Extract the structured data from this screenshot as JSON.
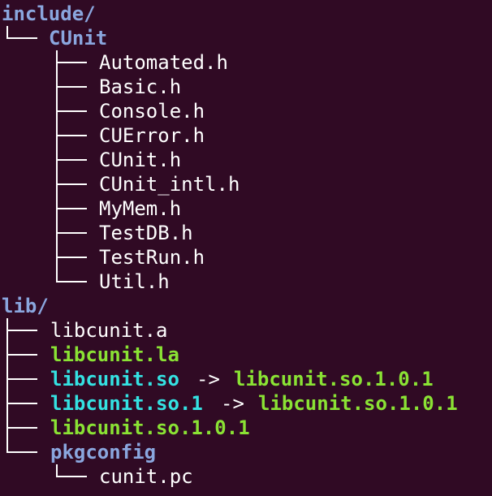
{
  "tree": {
    "include": {
      "label": "include/",
      "sub": {
        "label": "CUnit",
        "files": [
          "Automated.h",
          "Basic.h",
          "Console.h",
          "CUError.h",
          "CUnit.h",
          "CUnit_intl.h",
          "MyMem.h",
          "TestDB.h",
          "TestRun.h",
          "Util.h"
        ]
      }
    },
    "lib": {
      "label": "lib/",
      "items": [
        {
          "name": "libcunit.a",
          "kind": "file"
        },
        {
          "name": "libcunit.la",
          "kind": "exec"
        },
        {
          "name": "libcunit.so",
          "kind": "link",
          "arrow": "->",
          "target": "libcunit.so.1.0.1"
        },
        {
          "name": "libcunit.so.1",
          "kind": "link",
          "arrow": "->",
          "target": "libcunit.so.1.0.1"
        },
        {
          "name": "libcunit.so.1.0.1",
          "kind": "exec"
        },
        {
          "name": "pkgconfig",
          "kind": "dir"
        }
      ],
      "pkgconfig_files": [
        "cunit.pc"
      ]
    }
  },
  "colors": {
    "background": "#300a24",
    "directory": "#8aa6de",
    "file": "#ffffff",
    "executable": "#8ae234",
    "symlink": "#34e2e2"
  }
}
